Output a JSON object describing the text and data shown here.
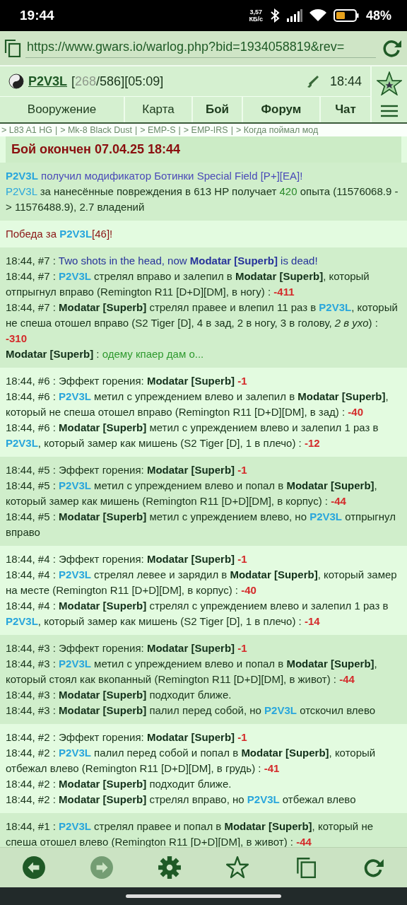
{
  "status_bar": {
    "time": "19:44",
    "speed_value": "3,57",
    "speed_unit": "КБ/с",
    "battery": "48%"
  },
  "browser": {
    "url": "https://www.gwars.io/warlog.php?bid=1934058819&rev="
  },
  "header": {
    "player": "P2V3L",
    "stats": [
      {
        "kind": "text",
        "text": "["
      },
      {
        "kind": "dim",
        "text": "268"
      },
      {
        "kind": "text",
        "text": "/586][05:09]"
      }
    ],
    "time": "18:44"
  },
  "tabs": [
    {
      "label": "Вооружение",
      "bold": false
    },
    {
      "label": "Карта",
      "bold": false
    },
    {
      "label": "Бой",
      "bold": true
    },
    {
      "label": "Форум",
      "bold": true
    },
    {
      "label": "Чат",
      "bold": true
    }
  ],
  "breadcrumb": {
    "separator": "|",
    "items": [
      "> L83 A1 HG",
      "> Mk-8 Black Dust",
      "> EMP-S",
      "> EMP-IRS",
      "> Когда поймал мод"
    ]
  },
  "battle_title": "Бой окончен 07.04.25 18:44",
  "summary": [
    [
      {
        "kind": "player",
        "text": "P2V3L"
      },
      {
        "kind": "mod",
        "text": " получил модификатор Ботинки Special Field [P+][EA]!"
      }
    ],
    [
      {
        "kind": "player_plain",
        "text": "P2V3L"
      },
      {
        "kind": "text",
        "text": " за нанесённые повреждения в 613 HP получает "
      },
      {
        "kind": "exp",
        "text": "420"
      },
      {
        "kind": "text",
        "text": " опыта (11576068.9 -> 11576488.9), 2.7 владений"
      }
    ]
  ],
  "victory": [
    {
      "kind": "victory",
      "text": "Победа за "
    },
    {
      "kind": "player",
      "text": "P2V3L"
    },
    {
      "kind": "victory",
      "text": "[46]!"
    }
  ],
  "turns": [
    [
      [
        {
          "kind": "text",
          "text": "18:44, #7 : "
        },
        {
          "kind": "announce",
          "text": "Two shots in the head, now "
        },
        {
          "kind": "announce_bold",
          "text": "Modatar [Superb]"
        },
        {
          "kind": "announce",
          "text": " is dead!"
        }
      ],
      [
        {
          "kind": "text",
          "text": "18:44, #7 : "
        },
        {
          "kind": "player",
          "text": "P2V3L"
        },
        {
          "kind": "text",
          "text": " стрелял вправо и залепил в "
        },
        {
          "kind": "enemy",
          "text": "Modatar [Superb]"
        },
        {
          "kind": "text",
          "text": ", который отпрыгнул вправо (Remington R11 [D+D][DM], в ногу) : "
        },
        {
          "kind": "damage",
          "text": "-411"
        }
      ],
      [
        {
          "kind": "text",
          "text": "18:44, #7 : "
        },
        {
          "kind": "enemy",
          "text": "Modatar [Superb]"
        },
        {
          "kind": "text",
          "text": " стрелял правее и влепил 11 раз в "
        },
        {
          "kind": "player",
          "text": "P2V3L"
        },
        {
          "kind": "text",
          "text": ", который не спеша отошел вправо (S2 Tiger [D], 4 в зад, 2 в ногу, 3 в голову, "
        },
        {
          "kind": "italic",
          "text": "2 в ухо"
        },
        {
          "kind": "text",
          "text": ") : "
        },
        {
          "kind": "damage",
          "text": "-310"
        }
      ],
      [
        {
          "kind": "enemy",
          "text": "Modatar [Superb]"
        },
        {
          "kind": "text",
          "text": " : "
        },
        {
          "kind": "chat",
          "text": "одему кпаер дам о..."
        }
      ]
    ],
    [
      [
        {
          "kind": "text",
          "text": "18:44, #6 : Эффект горения: "
        },
        {
          "kind": "enemy",
          "text": "Modatar [Superb]"
        },
        {
          "kind": "damage",
          "text": "-1"
        }
      ],
      [
        {
          "kind": "text",
          "text": "18:44, #6 : "
        },
        {
          "kind": "player",
          "text": "P2V3L"
        },
        {
          "kind": "text",
          "text": " метил с упреждением влево и залепил в "
        },
        {
          "kind": "enemy",
          "text": "Modatar [Superb]"
        },
        {
          "kind": "text",
          "text": ", который не спеша отошел вправо (Remington R11 [D+D][DM], в зад) : "
        },
        {
          "kind": "damage",
          "text": "-40"
        }
      ],
      [
        {
          "kind": "text",
          "text": "18:44, #6 : "
        },
        {
          "kind": "enemy",
          "text": "Modatar [Superb]"
        },
        {
          "kind": "text",
          "text": " метил с упреждением влево и залепил 1 раз в "
        },
        {
          "kind": "player",
          "text": "P2V3L"
        },
        {
          "kind": "text",
          "text": ", который замер как мишень (S2 Tiger [D], 1 в плечо) : "
        },
        {
          "kind": "damage",
          "text": "-12"
        }
      ]
    ],
    [
      [
        {
          "kind": "text",
          "text": "18:44, #5 : Эффект горения: "
        },
        {
          "kind": "enemy",
          "text": "Modatar [Superb]"
        },
        {
          "kind": "damage",
          "text": "-1"
        }
      ],
      [
        {
          "kind": "text",
          "text": "18:44, #5 : "
        },
        {
          "kind": "player",
          "text": "P2V3L"
        },
        {
          "kind": "text",
          "text": " метил с упреждением влево и попал в "
        },
        {
          "kind": "enemy",
          "text": "Modatar [Superb]"
        },
        {
          "kind": "text",
          "text": ", который замер как мишень (Remington R11 [D+D][DM], в корпус) : "
        },
        {
          "kind": "damage",
          "text": "-44"
        }
      ],
      [
        {
          "kind": "text",
          "text": "18:44, #5 : "
        },
        {
          "kind": "enemy",
          "text": "Modatar [Superb]"
        },
        {
          "kind": "text",
          "text": " метил с упреждением влево, но "
        },
        {
          "kind": "player",
          "text": "P2V3L"
        },
        {
          "kind": "text",
          "text": " отпрыгнул вправо"
        }
      ]
    ],
    [
      [
        {
          "kind": "text",
          "text": "18:44, #4 : Эффект горения: "
        },
        {
          "kind": "enemy",
          "text": "Modatar [Superb]"
        },
        {
          "kind": "damage",
          "text": "-1"
        }
      ],
      [
        {
          "kind": "text",
          "text": "18:44, #4 : "
        },
        {
          "kind": "player",
          "text": "P2V3L"
        },
        {
          "kind": "text",
          "text": " стрелял левее и зарядил в "
        },
        {
          "kind": "enemy",
          "text": "Modatar [Superb]"
        },
        {
          "kind": "text",
          "text": ", который замер на месте (Remington R11 [D+D][DM], в корпус) : "
        },
        {
          "kind": "damage",
          "text": "-40"
        }
      ],
      [
        {
          "kind": "text",
          "text": "18:44, #4 : "
        },
        {
          "kind": "enemy",
          "text": "Modatar [Superb]"
        },
        {
          "kind": "text",
          "text": " стрелял с упреждением влево и залепил 1 раз в "
        },
        {
          "kind": "player",
          "text": "P2V3L"
        },
        {
          "kind": "text",
          "text": ", который замер как мишень (S2 Tiger [D], 1 в плечо) : "
        },
        {
          "kind": "damage",
          "text": "-14"
        }
      ]
    ],
    [
      [
        {
          "kind": "text",
          "text": "18:44, #3 : Эффект горения: "
        },
        {
          "kind": "enemy",
          "text": "Modatar [Superb]"
        },
        {
          "kind": "damage",
          "text": "-1"
        }
      ],
      [
        {
          "kind": "text",
          "text": "18:44, #3 : "
        },
        {
          "kind": "player",
          "text": "P2V3L"
        },
        {
          "kind": "text",
          "text": " метил с упреждением влево и попал в "
        },
        {
          "kind": "enemy",
          "text": "Modatar [Superb]"
        },
        {
          "kind": "text",
          "text": ", который стоял как вкопанный (Remington R11 [D+D][DM], в живот) : "
        },
        {
          "kind": "damage",
          "text": "-44"
        }
      ],
      [
        {
          "kind": "text",
          "text": "18:44, #3 : "
        },
        {
          "kind": "enemy",
          "text": "Modatar [Superb]"
        },
        {
          "kind": "text",
          "text": " подходит ближе."
        }
      ],
      [
        {
          "kind": "text",
          "text": "18:44, #3 : "
        },
        {
          "kind": "enemy",
          "text": "Modatar [Superb]"
        },
        {
          "kind": "text",
          "text": " палил перед собой, но "
        },
        {
          "kind": "player",
          "text": "P2V3L"
        },
        {
          "kind": "text",
          "text": " отскочил влево"
        }
      ]
    ],
    [
      [
        {
          "kind": "text",
          "text": "18:44, #2 : Эффект горения: "
        },
        {
          "kind": "enemy",
          "text": "Modatar [Superb]"
        },
        {
          "kind": "damage",
          "text": "-1"
        }
      ],
      [
        {
          "kind": "text",
          "text": "18:44, #2 : "
        },
        {
          "kind": "player",
          "text": "P2V3L"
        },
        {
          "kind": "text",
          "text": " палил перед собой и попал в "
        },
        {
          "kind": "enemy",
          "text": "Modatar [Superb]"
        },
        {
          "kind": "text",
          "text": ", который отбежал влево (Remington R11 [D+D][DM], в грудь) : "
        },
        {
          "kind": "damage",
          "text": "-41"
        }
      ],
      [
        {
          "kind": "text",
          "text": "18:44, #2 : "
        },
        {
          "kind": "enemy",
          "text": "Modatar [Superb]"
        },
        {
          "kind": "text",
          "text": " подходит ближе."
        }
      ],
      [
        {
          "kind": "text",
          "text": "18:44, #2 : "
        },
        {
          "kind": "enemy",
          "text": "Modatar [Superb]"
        },
        {
          "kind": "text",
          "text": " стрелял вправо, но "
        },
        {
          "kind": "player",
          "text": "P2V3L"
        },
        {
          "kind": "text",
          "text": " отбежал влево"
        }
      ]
    ],
    [
      [
        {
          "kind": "text",
          "text": "18:44, #1 : "
        },
        {
          "kind": "player",
          "text": "P2V3L"
        },
        {
          "kind": "text",
          "text": " стрелял правее и попал в "
        },
        {
          "kind": "enemy",
          "text": "Modatar [Superb]"
        },
        {
          "kind": "text",
          "text": ", который не спеша отошел влево (Remington R11 [D+D][DM], в живот) : "
        },
        {
          "kind": "damage",
          "text": "-44"
        }
      ]
    ]
  ],
  "toolbar": [
    {
      "kind": "back",
      "disabled": false
    },
    {
      "kind": "forward",
      "disabled": true
    },
    {
      "kind": "settings",
      "disabled": false
    },
    {
      "kind": "bookmark",
      "disabled": false
    },
    {
      "kind": "tabs",
      "disabled": false
    },
    {
      "kind": "reload",
      "disabled": false
    }
  ]
}
